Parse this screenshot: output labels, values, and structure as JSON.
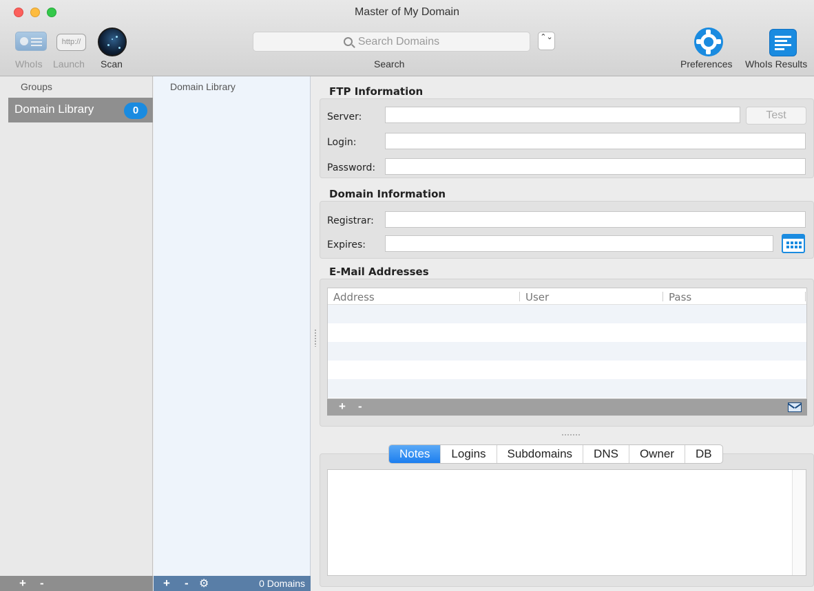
{
  "window": {
    "title": "Master of My Domain"
  },
  "toolbar": {
    "whois_label": "WhoIs",
    "launch_label": "Launch",
    "launch_icon_text": "http://",
    "scan_label": "Scan",
    "search_placeholder": "Search Domains",
    "search_label": "Search",
    "stepper_glyph": "⌃⌄",
    "preferences_label": "Preferences",
    "whois_results_label": "WhoIs Results"
  },
  "groups": {
    "header": "Groups",
    "items": [
      {
        "label": "Domain Library",
        "count": "0"
      }
    ],
    "add": "+",
    "remove": "-"
  },
  "library": {
    "header": "Domain Library",
    "footer": {
      "add": "+",
      "remove": "-",
      "count_text": "0 Domains"
    }
  },
  "ftp": {
    "title": "FTP Information",
    "server_label": "Server:",
    "server_value": "",
    "test_button": "Test",
    "login_label": "Login:",
    "login_value": "",
    "password_label": "Password:",
    "password_value": ""
  },
  "domain_info": {
    "title": "Domain Information",
    "registrar_label": "Registrar:",
    "registrar_value": "",
    "expires_label": "Expires:",
    "expires_value": ""
  },
  "email": {
    "title": "E-Mail Addresses",
    "columns": [
      "Address",
      "User",
      "Pass"
    ],
    "add": "+",
    "remove": "-"
  },
  "tabs": {
    "items": [
      "Notes",
      "Logins",
      "Subdomains",
      "DNS",
      "Owner",
      "DB"
    ],
    "active": "Notes",
    "notes_value": ""
  },
  "colors": {
    "accent": "#1a8be0",
    "selection": "#8f8f8f",
    "library_bg": "#eef4fb"
  }
}
